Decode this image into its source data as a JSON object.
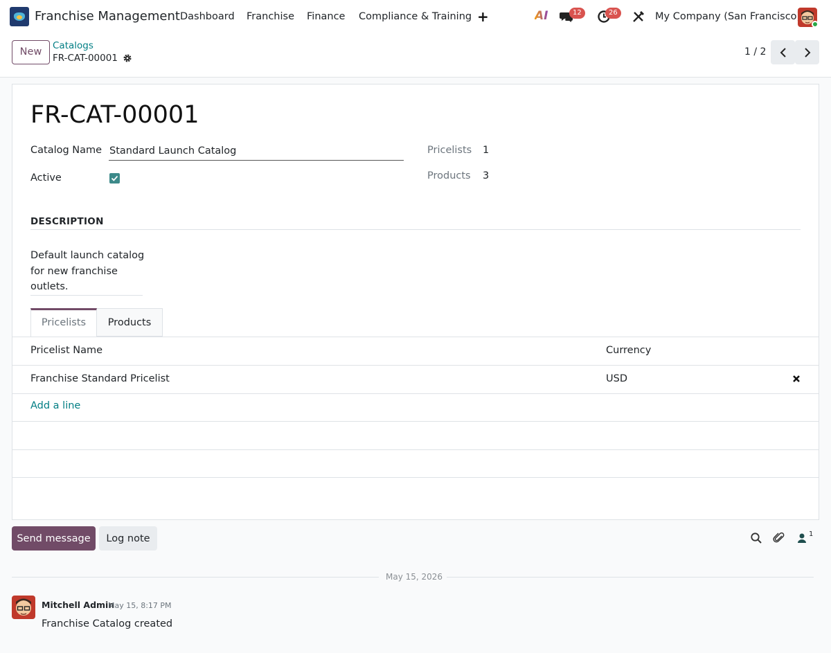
{
  "navbar": {
    "app_title": "Franchise Management",
    "menu": [
      "Dashboard",
      "Franchise",
      "Finance",
      "Compliance & Training"
    ],
    "ai_label": "AI",
    "messages_count": "12",
    "activities_count": "26",
    "company": "My Company (San Francisco)"
  },
  "controlbar": {
    "new_label": "New",
    "breadcrumb_parent": "Catalogs",
    "breadcrumb_current": "FR-CAT-00001",
    "pager": "1 / 2"
  },
  "form": {
    "title": "FR-CAT-00001",
    "catalog_name_label": "Catalog Name",
    "catalog_name_value": "Standard Launch Catalog",
    "active_label": "Active",
    "active": true,
    "pricelists_label": "Pricelists",
    "pricelists_count": "1",
    "products_label": "Products",
    "products_count": "3",
    "description_heading": "DESCRIPTION",
    "description": "Default launch catalog for new franchise outlets."
  },
  "tabs": [
    {
      "label": "Pricelists",
      "active": true
    },
    {
      "label": "Products",
      "active": false
    }
  ],
  "table": {
    "columns": [
      "Pricelist Name",
      "Currency"
    ],
    "rows": [
      {
        "name": "Franchise Standard Pricelist",
        "currency": "USD"
      }
    ],
    "add_line": "Add a line"
  },
  "chatter": {
    "send_message": "Send message",
    "log_note": "Log note",
    "followers": "1",
    "date_separator": "May 15, 2026",
    "messages": [
      {
        "author": "Mitchell Admin",
        "date": "May 15, 8:17 PM",
        "body": "Franchise Catalog created"
      }
    ]
  },
  "colors": {
    "brand": "#714b67",
    "link": "#017e84",
    "checkbox": "#3d8a8a",
    "badge": "#d9534f"
  }
}
